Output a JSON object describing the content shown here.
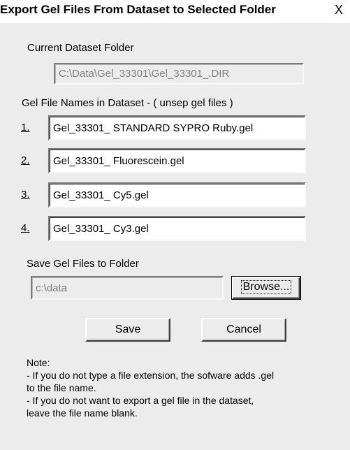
{
  "window": {
    "title": "Export Gel Files From Dataset to Selected Folder",
    "close_label": "X"
  },
  "current_folder": {
    "label": "Current Dataset Folder",
    "value": "C:\\Data\\Gel_33301\\Gel_33301_.DIR"
  },
  "gel_files": {
    "label": "Gel File Names in Dataset   -  ( unsep gel files )",
    "items": [
      {
        "number": "1.",
        "value": "Gel_33301_ STANDARD SYPRO Ruby.gel"
      },
      {
        "number": "2.",
        "value": "Gel_33301_ Fluorescein.gel"
      },
      {
        "number": "3.",
        "value": "Gel_33301_ Cy5.gel"
      },
      {
        "number": "4.",
        "value": "Gel_33301_ Cy3.gel"
      }
    ]
  },
  "save_folder": {
    "label": "Save Gel Files to Folder",
    "value": "c:\\data",
    "browse_label": "Browse..."
  },
  "buttons": {
    "save_label": "Save",
    "cancel_label": "Cancel"
  },
  "note": {
    "heading": "Note:",
    "line1": "- If you do not type a file extension, the sofware adds .gel",
    "line2": "to the file name.",
    "line3": "- If you do not want to export a gel file in the dataset,",
    "line4": "leave the file name blank."
  }
}
